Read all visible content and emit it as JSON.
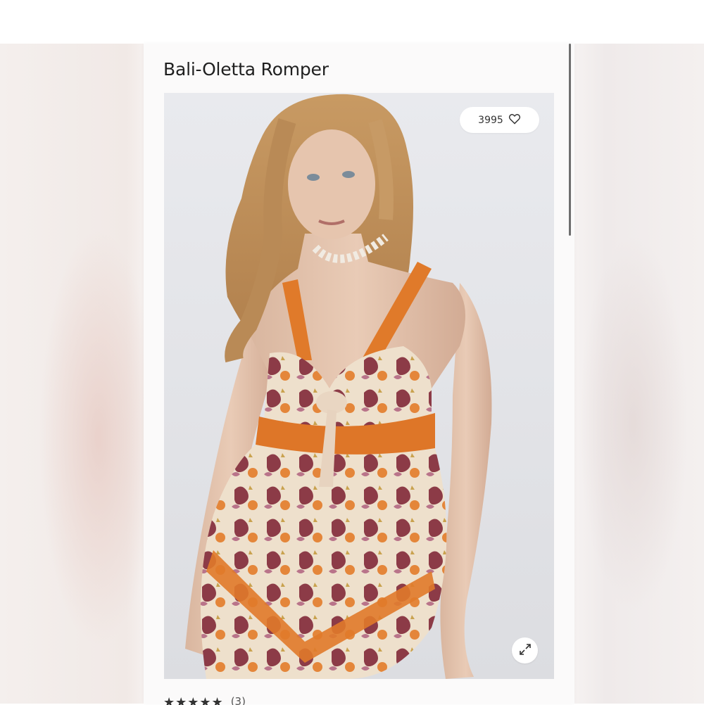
{
  "product": {
    "title": "Bali-Oletta Romper",
    "likes": "3995",
    "rating_stars": "★★★★★",
    "review_count": "(3)"
  },
  "icons": {
    "like": "heart-outline-icon",
    "expand": "expand-arrows-icon"
  },
  "colors": {
    "page_background": "#ffffff",
    "card_background": "#fbfafa",
    "photo_background": "#e4e6ea",
    "print_orange": "#e07a2a",
    "print_cream": "#efe1cf",
    "print_burgundy": "#8b3a46"
  }
}
